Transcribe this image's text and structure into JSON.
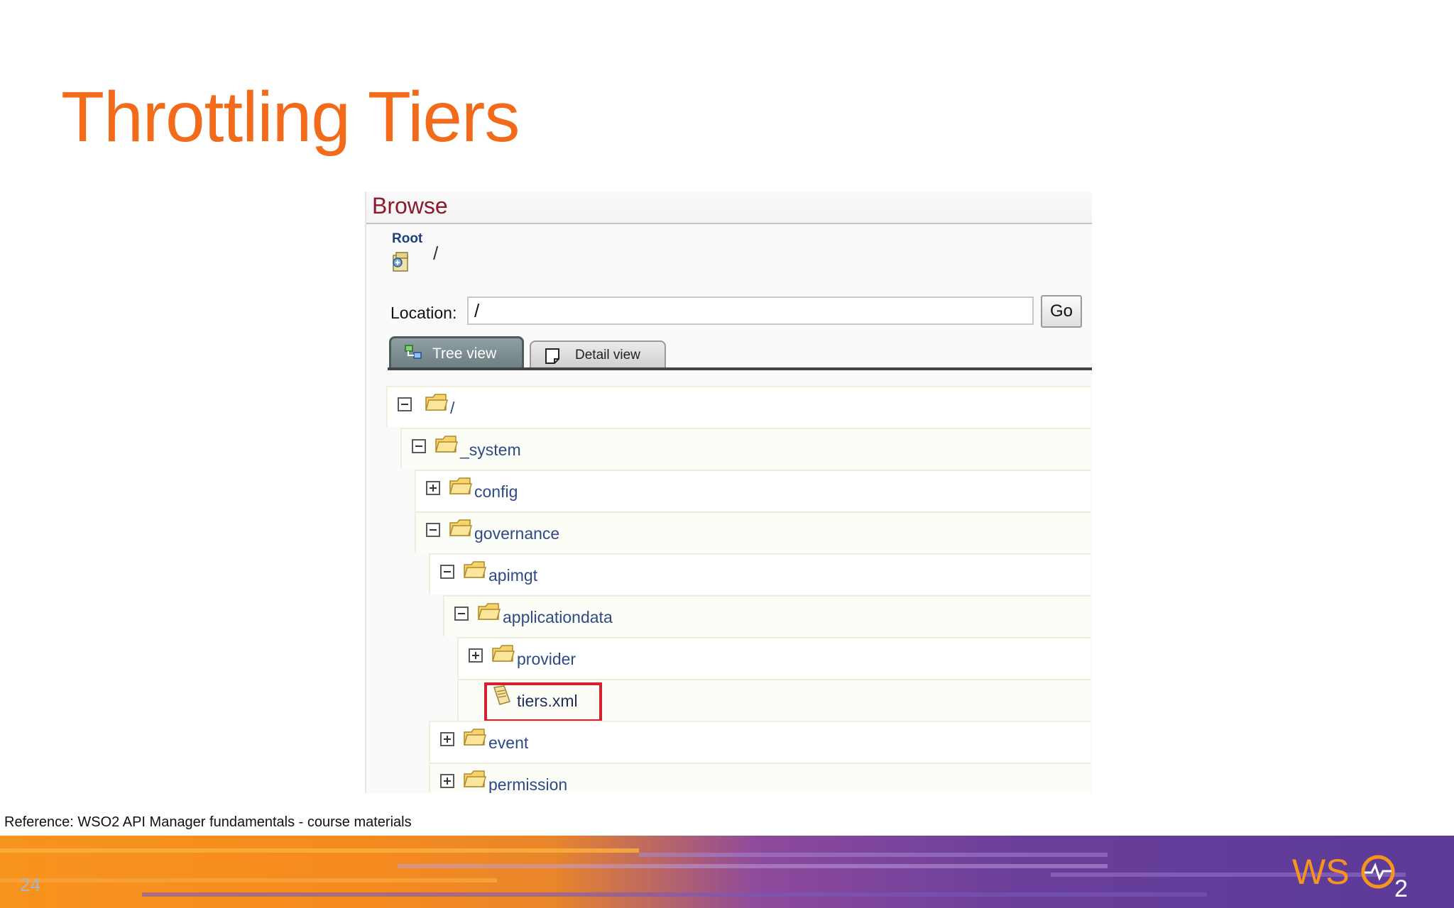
{
  "slide": {
    "title": "Throttling Tiers",
    "reference": "Reference: WSO2 API Manager fundamentals - course materials",
    "page_number": "24",
    "logo_text": "WSO2"
  },
  "browser": {
    "header_title": "Browse",
    "root_label": "Root",
    "root_path": "/",
    "location_label": "Location:",
    "location_value": "/",
    "go_label": "Go",
    "tabs": [
      {
        "label": "Tree view",
        "active": true
      },
      {
        "label": "Detail view",
        "active": false
      }
    ],
    "tree": [
      {
        "label": "/",
        "toggle": "minus",
        "type": "folder"
      },
      {
        "label": "_system",
        "toggle": "minus",
        "type": "folder"
      },
      {
        "label": "config",
        "toggle": "plus",
        "type": "folder"
      },
      {
        "label": "governance",
        "toggle": "minus",
        "type": "folder"
      },
      {
        "label": "apimgt",
        "toggle": "minus",
        "type": "folder"
      },
      {
        "label": "applicationdata",
        "toggle": "minus",
        "type": "folder"
      },
      {
        "label": "provider",
        "toggle": "plus",
        "type": "folder"
      },
      {
        "label": "tiers.xml",
        "toggle": "none",
        "type": "file",
        "highlighted": true
      },
      {
        "label": "event",
        "toggle": "plus",
        "type": "folder"
      },
      {
        "label": "permission",
        "toggle": "plus",
        "type": "folder"
      }
    ]
  },
  "colors": {
    "title": "#f26b1b",
    "browse_title": "#8b1a2b",
    "tree_link": "#2e4a86",
    "highlight": "#d3202f"
  }
}
